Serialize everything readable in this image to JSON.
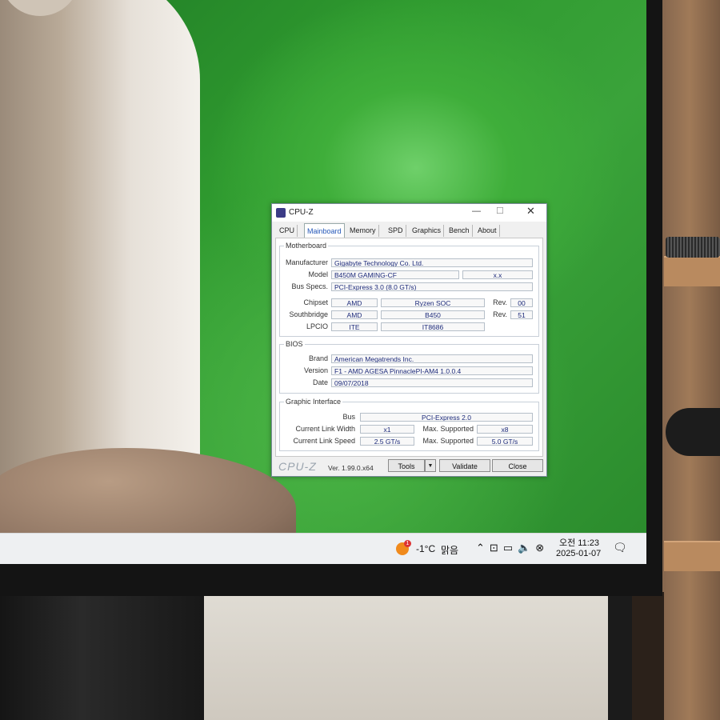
{
  "window": {
    "title": "CPU-Z",
    "controls": {
      "minimize": "—",
      "maximize": "☐",
      "close": "✕"
    }
  },
  "tabs": [
    "CPU",
    "Mainboard",
    "Memory",
    "SPD",
    "Graphics",
    "Bench",
    "About"
  ],
  "active_tab": "Mainboard",
  "motherboard": {
    "section": "Motherboard",
    "manufacturer_label": "Manufacturer",
    "manufacturer": "Gigabyte Technology Co. Ltd.",
    "model_label": "Model",
    "model": "B450M GAMING-CF",
    "model_rev": "x.x",
    "bus_label": "Bus Specs.",
    "bus": "PCI-Express 3.0 (8.0 GT/s)",
    "chipset_label": "Chipset",
    "chipset_vendor": "AMD",
    "chipset_name": "Ryzen SOC",
    "chipset_rev_label": "Rev.",
    "chipset_rev": "00",
    "southbridge_label": "Southbridge",
    "southbridge_vendor": "AMD",
    "southbridge_name": "B450",
    "southbridge_rev_label": "Rev.",
    "southbridge_rev": "51",
    "lpcio_label": "LPCIO",
    "lpcio_vendor": "ITE",
    "lpcio_name": "IT8686"
  },
  "bios": {
    "section": "BIOS",
    "brand_label": "Brand",
    "brand": "American Megatrends Inc.",
    "version_label": "Version",
    "version": "F1 - AMD AGESA PinnaclePI-AM4 1.0.0.4",
    "date_label": "Date",
    "date": "09/07/2018"
  },
  "graphic_interface": {
    "section": "Graphic Interface",
    "bus_label": "Bus",
    "bus": "PCI-Express 2.0",
    "link_width_label": "Current Link Width",
    "link_width": "x1",
    "max_width_label": "Max. Supported",
    "max_width": "x8",
    "link_speed_label": "Current Link Speed",
    "link_speed": "2.5 GT/s",
    "max_speed_label": "Max. Supported",
    "max_speed": "5.0 GT/s"
  },
  "footer": {
    "logo": "CPU-Z",
    "version": "Ver. 1.99.0.x64",
    "tools_label": "Tools",
    "validate_label": "Validate",
    "close_label": "Close"
  },
  "taskbar": {
    "weather_badge": "1",
    "temperature": "-1°C",
    "condition": "맑음",
    "tray_icons": [
      "chevron-up-icon",
      "network-icon",
      "display-icon",
      "volume-icon",
      "mute-icon"
    ],
    "time": "오전 11:23",
    "date": "2025-01-07"
  }
}
